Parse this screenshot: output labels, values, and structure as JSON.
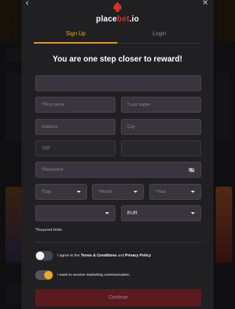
{
  "brand": {
    "name_main": "place",
    "name_accent": "bet",
    "name_suffix": ".io",
    "accent_color": "#e02c2c"
  },
  "tabs": [
    {
      "label": "Sign Up",
      "active": true
    },
    {
      "label": "Login",
      "active": false
    }
  ],
  "headline": "You are one step closer to reward!",
  "form": {
    "email": {
      "placeholder": "",
      "value": ""
    },
    "first_name": {
      "placeholder": "*First name"
    },
    "last_name": {
      "placeholder": "*Last name"
    },
    "address": {
      "placeholder": "Address"
    },
    "city": {
      "placeholder": "City"
    },
    "zip": {
      "placeholder": "*ZIP"
    },
    "extra": {
      "placeholder": ""
    },
    "password": {
      "placeholder": "*Password"
    },
    "day": {
      "placeholder": "*Day"
    },
    "month": {
      "placeholder": "*Month"
    },
    "year": {
      "placeholder": "*Year"
    },
    "country": {
      "value": ""
    },
    "currency": {
      "value": "EUR"
    }
  },
  "required_note": "*Required fields",
  "consents": [
    {
      "prefix": "I agree to the ",
      "link1": "Terms & Conditions",
      "mid": " and ",
      "link2": "Privacy Policy",
      "checked": false
    },
    {
      "text": "I want to receive marketing communication.",
      "checked": true
    }
  ],
  "continue_label": "Continue",
  "colors": {
    "accent": "#f5a623",
    "continue_bg": "#5c1a1f"
  }
}
